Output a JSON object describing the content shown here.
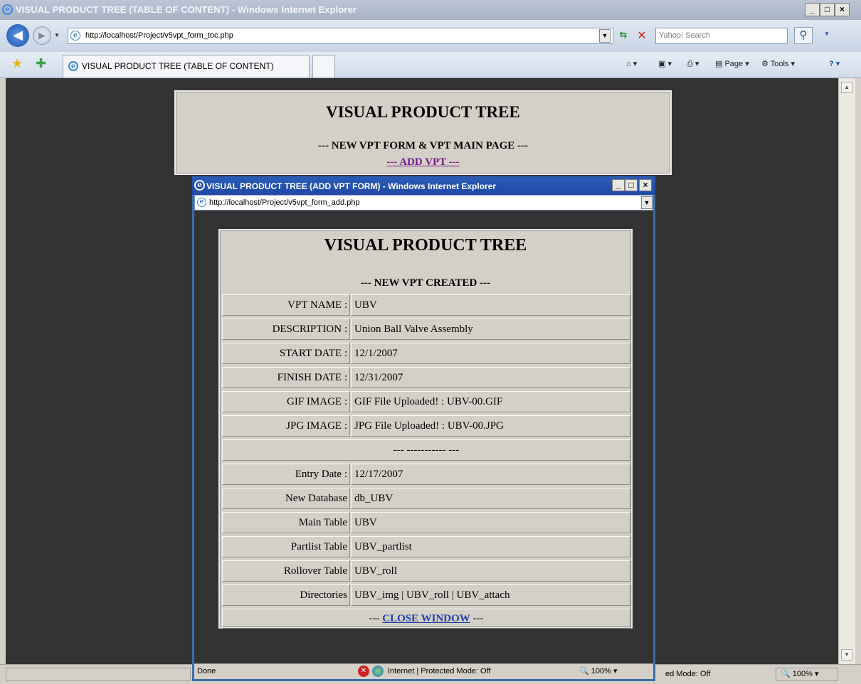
{
  "browser": {
    "title": "VISUAL PRODUCT TREE (TABLE OF CONTENT) - Windows Internet Explorer",
    "url": "http://localhost/Project/v5vpt_form_toc.php",
    "search_placeholder": "Yahoo! Search",
    "tab_label": "VISUAL PRODUCT TREE (TABLE OF CONTENT)",
    "toolbar": {
      "page_label": "Page",
      "tools_label": "Tools"
    },
    "status": {
      "mode": "ed Mode: Off",
      "zoom": "100%"
    }
  },
  "toc_page": {
    "title": "VISUAL PRODUCT TREE",
    "subtitle": "--- NEW VPT FORM & VPT MAIN PAGE ---",
    "add_link": "--- ADD VPT ---"
  },
  "popup": {
    "title": "VISUAL PRODUCT TREE (ADD VPT FORM) - Windows Internet Explorer",
    "url": "http://localhost/Project/v5vpt_form_add.php",
    "status": {
      "left": "Done",
      "zone": "Internet | Protected Mode: Off",
      "zoom": "100%"
    }
  },
  "form": {
    "title": "VISUAL PRODUCT TREE",
    "subtitle": "--- NEW VPT CREATED ---",
    "rows": [
      {
        "label": "VPT NAME :",
        "value": "UBV"
      },
      {
        "label": "DESCRIPTION :",
        "value": "Union Ball Valve Assembly"
      },
      {
        "label": "START DATE :",
        "value": "12/1/2007"
      },
      {
        "label": "FINISH DATE :",
        "value": "12/31/2007"
      },
      {
        "label": "GIF IMAGE :",
        "value": "GIF File Uploaded! : UBV-00.GIF"
      },
      {
        "label": "JPG IMAGE :",
        "value": "JPG File Uploaded! : UBV-00.JPG"
      }
    ],
    "separator": "--- ----------- ---",
    "info_rows": [
      {
        "label": "Entry Date :",
        "value": "12/17/2007"
      },
      {
        "label": "New Database",
        "value": "db_UBV"
      },
      {
        "label": "Main Table",
        "value": "UBV"
      },
      {
        "label": "Partlist Table",
        "value": "UBV_partlist"
      },
      {
        "label": "Rollover Table",
        "value": "UBV_roll"
      },
      {
        "label": "Directories",
        "value": "UBV_img | UBV_roll | UBV_attach"
      }
    ],
    "close_prefix": "--- ",
    "close_label": "CLOSE WINDOW",
    "close_suffix": " ---"
  }
}
